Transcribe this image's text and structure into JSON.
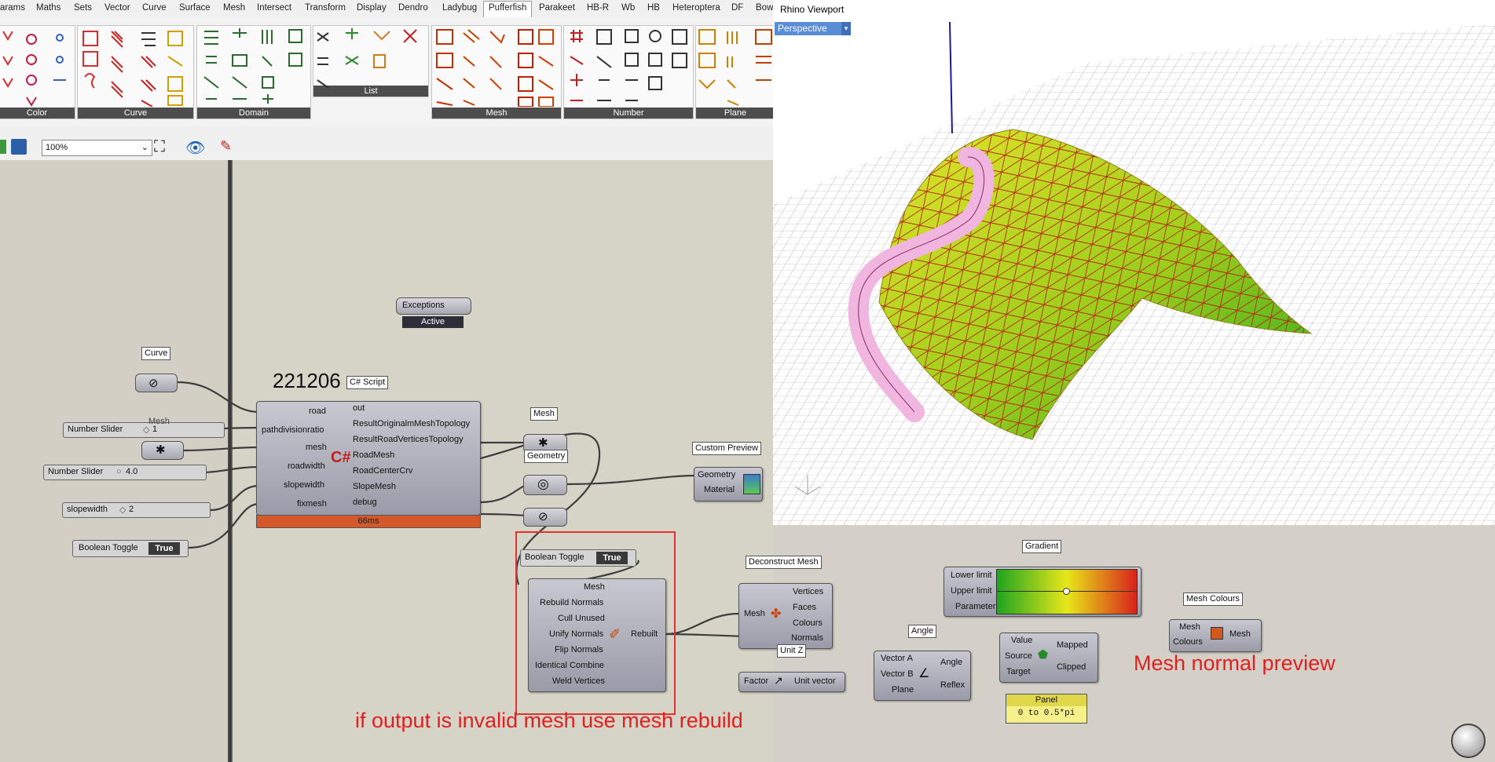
{
  "tabs": [
    "arams",
    "Maths",
    "Sets",
    "Vector",
    "Curve",
    "Surface",
    "Mesh",
    "Intersect",
    "Transform",
    "Display",
    "Dendro",
    "Ladybug",
    "Pufferfish",
    "Parakeet",
    "HB-R",
    "Wb",
    "HB",
    "Heteroptera",
    "DF",
    "Bow"
  ],
  "active_tab": "Pufferfish",
  "ribbon_groups": [
    "Color",
    "Curve",
    "Domain",
    "List",
    "Mesh",
    "Number",
    "Plane"
  ],
  "toolbar": {
    "zoom": "100%"
  },
  "viewport": {
    "title": "Rhino Viewport",
    "view": "Perspective"
  },
  "components": {
    "exceptions": {
      "name": "Exceptions",
      "status": "Active"
    },
    "curve_param": {
      "label": "Curve"
    },
    "mesh_param_left": {
      "label": "Mesh"
    },
    "number_slider_1": {
      "label": "Number Slider",
      "value": "1"
    },
    "number_slider_2": {
      "label": "Number Slider",
      "value": "4.0"
    },
    "slopewidth_slider": {
      "label": "slopewidth",
      "value": "2"
    },
    "boolean_toggle_left": {
      "label": "Boolean Toggle",
      "value": "True"
    },
    "script": {
      "id_text": "221206",
      "tag": "C# Script",
      "inputs": [
        "road",
        "pathdivisionratio",
        "mesh",
        "roadwidth",
        "slopewidth",
        "fixmesh"
      ],
      "outputs": [
        "out",
        "ResultOriginalmMeshTopology",
        "ResultRoadVerticesTopology",
        "RoadMesh",
        "RoadCenterCrv",
        "SlopeMesh",
        "debug"
      ],
      "runtime": "66ms"
    },
    "mesh_param_right": {
      "label": "Mesh"
    },
    "geometry_param": {
      "label": "Geometry"
    },
    "custom_preview": {
      "label": "Custom Preview",
      "inputs": [
        "Geometry",
        "Material"
      ]
    },
    "boolean_toggle_mid": {
      "label": "Boolean Toggle",
      "value": "True"
    },
    "rebuild": {
      "inputs": [
        "Mesh",
        "Rebuild Normals",
        "Cull Unused",
        "Unify Normals",
        "Flip Normals",
        "Identical Combine",
        "Weld Vertices"
      ],
      "output": "Rebuilt"
    },
    "deconstruct_mesh": {
      "label": "Deconstruct Mesh",
      "input": "Mesh",
      "outputs": [
        "Vertices",
        "Faces",
        "Colours",
        "Normals"
      ]
    },
    "unit_z": {
      "label": "Unit Z",
      "input": "Factor",
      "output": "Unit vector"
    },
    "angle": {
      "label": "Angle",
      "inputs": [
        "Vector A",
        "Vector B",
        "Plane"
      ],
      "outputs": [
        "Angle",
        "Reflex"
      ]
    },
    "gradient": {
      "label": "Gradient",
      "inputs": [
        "Lower limit",
        "Upper limit",
        "Parameter"
      ]
    },
    "remap": {
      "inputs": [
        "Value",
        "Source",
        "Target"
      ],
      "outputs": [
        "Mapped",
        "Clipped"
      ]
    },
    "panel": {
      "label": "Panel",
      "value": "0 to 0.5*pi"
    },
    "mesh_colours": {
      "label": "Mesh Colours",
      "inputs": [
        "Mesh",
        "Colours"
      ],
      "output": "Mesh"
    }
  },
  "annotations": {
    "rebuild_note": "if output is invalid mesh use mesh rebuild",
    "normal_preview": "Mesh normal preview"
  }
}
